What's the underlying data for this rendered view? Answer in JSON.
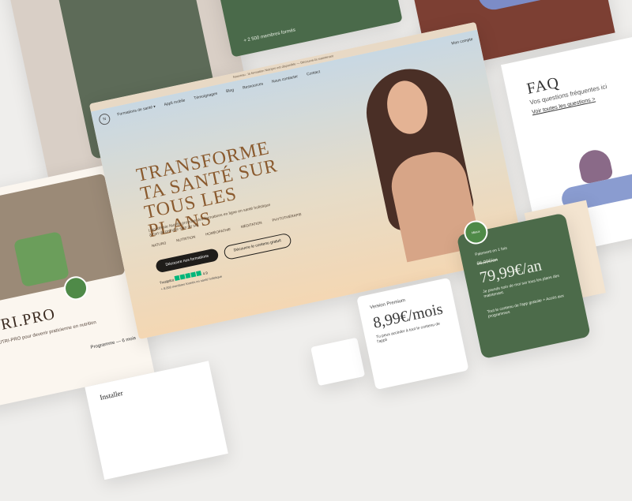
{
  "main": {
    "announcement": "Nouveau : la formation Nutripro est disponible — Découvre-la maintenant",
    "nav": {
      "logo": "N",
      "items": [
        "Formations de santé ▾",
        "Appli mobile",
        "Témoignages",
        "Blog",
        "Ressources",
        "Nous contacter",
        "Contact"
      ],
      "account": "Mon compte"
    },
    "hero": {
      "headline": "TRANSFORME TA SANTÉ SUR TOUS LES PLANS",
      "lede": "L'académie Nutriliv propose des formations en ligne en santé holistique à l'art de prendre soin de soi.",
      "pills": [
        "NATURO",
        "NUTRITION",
        "HOMÉOPATHIE",
        "MÉDITATION",
        "PHYTOTHÉRAPIE"
      ],
      "cta_primary": "Découvre nos formations",
      "cta_secondary": "Découvre le contenu gratuit",
      "trust_label": "Trustpilot",
      "trust_score": "4.9",
      "reviews": "+ 8.000 membres formés en santé holistique"
    }
  },
  "left_card": {
    "title": "UTRI.PRO",
    "desc": "...à la NUTRI-PRO pour devenir praticienne en nutrition",
    "program": "Programme — 6 mois",
    "arrow": "›"
  },
  "bottom_left": {
    "title": "Installer"
  },
  "green_top": {
    "text": "+ 2 500 membres formés"
  },
  "faq": {
    "title": "FAQ",
    "subtitle": "Vos questions fréquentes ici",
    "link": "Voir toutes les questions >"
  },
  "pricing": {
    "premium": {
      "label": "Version Premium",
      "price": "8,99€/mois",
      "desc": "Tu peux accéder à tout le contenu de l'appli"
    },
    "annual": {
      "badge": "Mieux",
      "label": "Paiement en 1 fois",
      "old_price": "96,00€/an",
      "price": "79,99€/an",
      "desc": "Je prends soin de moi sur tous les plans dès maintenant.",
      "extra": "Tout le contenu de l'app gratuite + Accès aux programmes"
    }
  }
}
